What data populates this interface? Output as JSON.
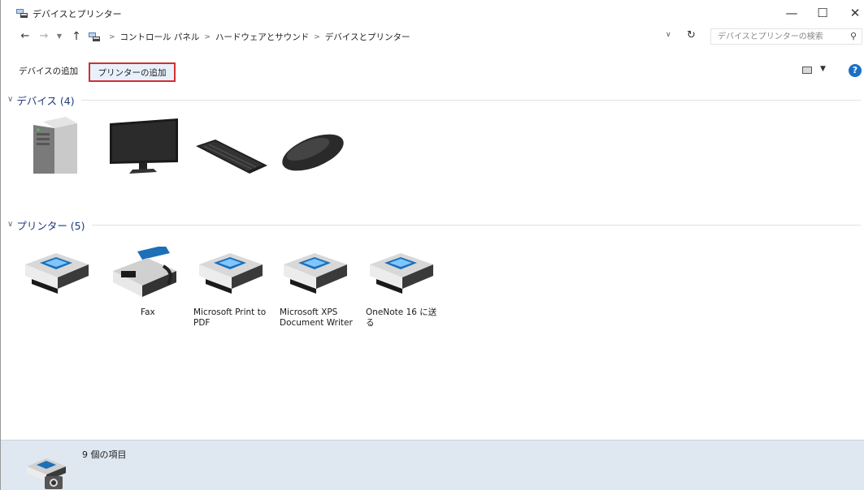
{
  "window": {
    "title": "デバイスとプリンター",
    "controls": {
      "minimize": "—",
      "maximize": "☐",
      "close": "✕"
    }
  },
  "address": {
    "breadcrumb": [
      "コントロール パネル",
      "ハードウェアとサウンド",
      "デバイスとプリンター"
    ],
    "search_placeholder": "デバイスとプリンターの検索"
  },
  "toolbar": {
    "add_device": "デバイスの追加",
    "add_printer": "プリンターの追加"
  },
  "groups": {
    "devices": {
      "title": "デバイス (4)",
      "items": [
        {
          "icon": "computer-tower-icon",
          "label": ""
        },
        {
          "icon": "monitor-icon",
          "label": ""
        },
        {
          "icon": "keyboard-icon",
          "label": ""
        },
        {
          "icon": "mouse-icon",
          "label": ""
        }
      ]
    },
    "printers": {
      "title": "プリンター (5)",
      "items": [
        {
          "icon": "printer-icon",
          "label": ""
        },
        {
          "icon": "fax-icon",
          "label": "Fax"
        },
        {
          "icon": "printer-icon",
          "label": "Microsoft Print to PDF"
        },
        {
          "icon": "printer-icon",
          "label": "Microsoft XPS Document Writer"
        },
        {
          "icon": "printer-icon",
          "label": "OneNote 16 に送る"
        }
      ]
    }
  },
  "status": {
    "count_text": "9 個の項目"
  },
  "colors": {
    "highlight_border": "#d32f2f",
    "group_title": "#1e3a7a",
    "status_bg": "#dfe7f1",
    "help_blue": "#1a6fc4"
  }
}
